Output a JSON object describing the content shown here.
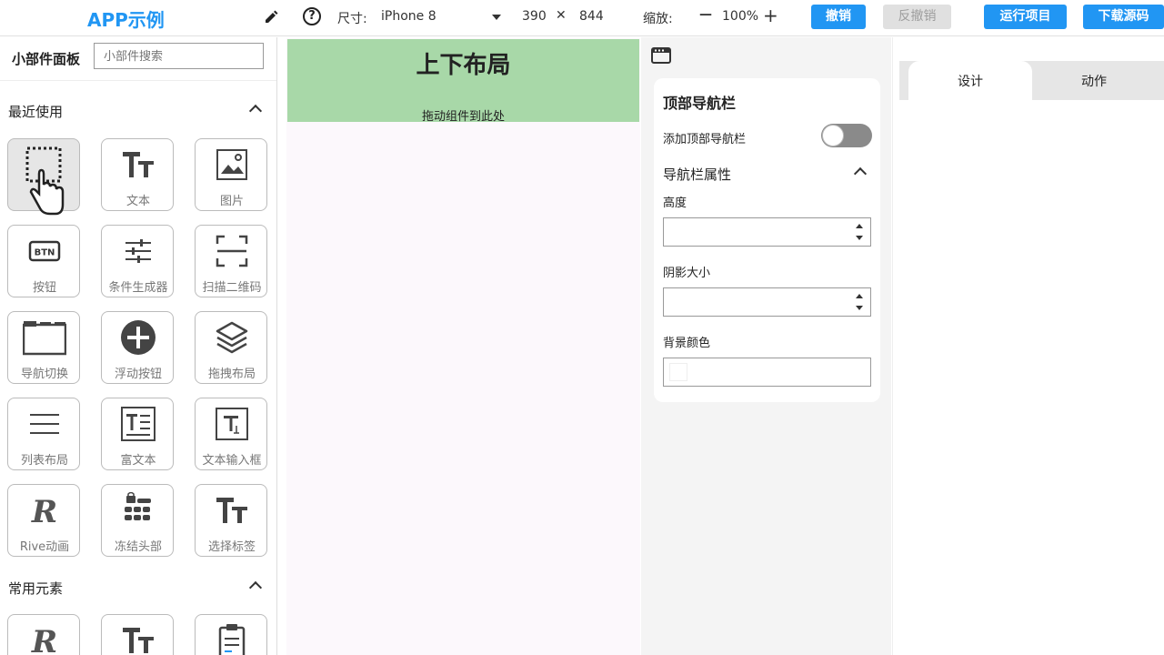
{
  "topbar": {
    "app_title": "APP示例",
    "size_label": "尺寸:",
    "device": "iPhone 8",
    "width": "390",
    "times": "✕",
    "height": "844",
    "zoom_label": "缩放:",
    "zoom_minus": "—",
    "zoom_value": "100%",
    "zoom_plus": "+",
    "undo": "撤销",
    "redo": "反撤销",
    "run": "运行项目",
    "download": "下载源码",
    "help": "?"
  },
  "left": {
    "title": "小部件面板",
    "search_placeholder": "小部件搜索",
    "recent_title": "最近使用",
    "common_title": "常用元素",
    "widgets": [
      {
        "label": "",
        "icon": "drag-hand-icon"
      },
      {
        "label": "文本",
        "icon": "text-icon"
      },
      {
        "label": "图片",
        "icon": "image-icon"
      },
      {
        "label": "按钮",
        "icon": "btn-icon"
      },
      {
        "label": "条件生成器",
        "icon": "sliders-icon"
      },
      {
        "label": "扫描二维码",
        "icon": "scan-icon"
      },
      {
        "label": "导航切换",
        "icon": "tab-window-icon"
      },
      {
        "label": "浮动按钮",
        "icon": "add-circle-icon"
      },
      {
        "label": "拖拽布局",
        "icon": "layers-icon"
      },
      {
        "label": "列表布局",
        "icon": "list-icon"
      },
      {
        "label": "富文本",
        "icon": "richtext-icon"
      },
      {
        "label": "文本输入框",
        "icon": "textfield-icon"
      },
      {
        "label": "Rive动画",
        "icon": "rive-icon"
      },
      {
        "label": "冻结头部",
        "icon": "freeze-header-icon"
      },
      {
        "label": "选择标签",
        "icon": "text-icon"
      }
    ],
    "common_icons": [
      "rive-icon",
      "text-icon",
      "clipboard-icon"
    ]
  },
  "canvas": {
    "title": "上下布局",
    "hint": "拖动组件到此处"
  },
  "props": {
    "card_title": "顶部导航栏",
    "add_nav_label": "添加顶部导航栏",
    "nav_props_title": "导航栏属性",
    "height_label": "高度",
    "shadow_label": "阴影大小",
    "bg_color_label": "背景颜色",
    "add_nav_on": false
  },
  "right": {
    "tabs": [
      {
        "label": "设计"
      },
      {
        "label": "动作"
      }
    ],
    "active_tab": 0
  },
  "colors": {
    "accent": "#2196f3",
    "canvas_header": "#a8d8a8"
  }
}
